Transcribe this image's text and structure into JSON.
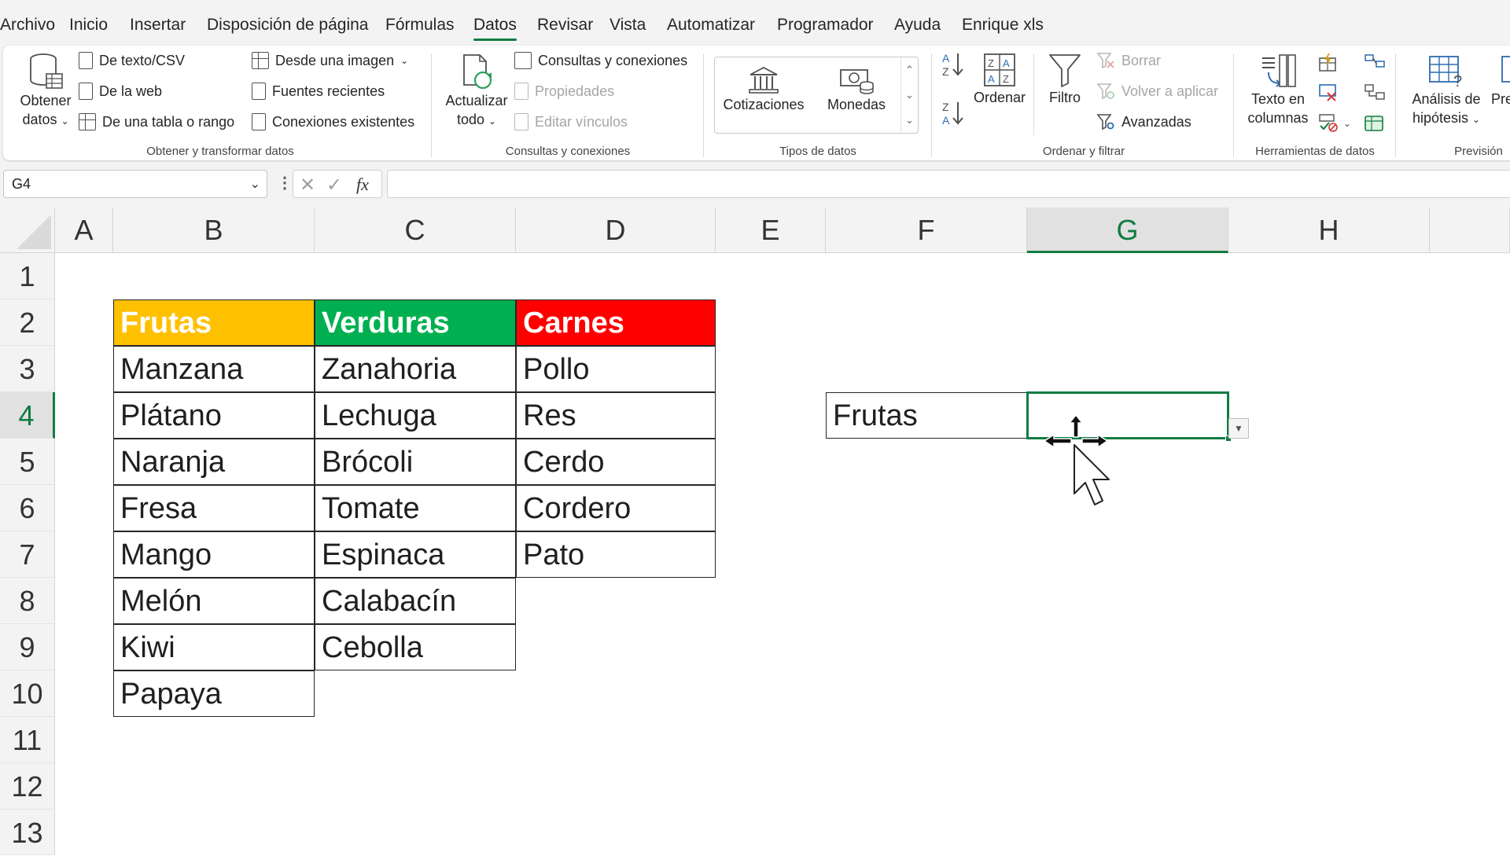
{
  "menu": {
    "tabs": [
      "Archivo",
      "Inicio",
      "Insertar",
      "Disposición de página",
      "Fórmulas",
      "Datos",
      "Revisar",
      "Vista",
      "Automatizar",
      "Programador",
      "Ayuda",
      "Enrique xls"
    ],
    "active": "Datos"
  },
  "ribbon": {
    "obtener_line1": "Obtener",
    "obtener_line2": "datos",
    "de_texto": "De texto/CSV",
    "de_web": "De la web",
    "de_tabla": "De una tabla o rango",
    "desde_imagen": "Desde una imagen",
    "fuentes_recientes": "Fuentes recientes",
    "conexiones_existentes": "Conexiones existentes",
    "group1": "Obtener y transformar datos",
    "actualizar_line1": "Actualizar",
    "actualizar_line2": "todo",
    "consultas_conexiones": "Consultas y conexiones",
    "propiedades": "Propiedades",
    "editar_vinculos": "Editar vínculos",
    "group2": "Consultas y conexiones",
    "cotizaciones": "Cotizaciones",
    "monedas": "Monedas",
    "group3": "Tipos de datos",
    "ordenar": "Ordenar",
    "filtro": "Filtro",
    "borrar": "Borrar",
    "volver_aplicar": "Volver a aplicar",
    "avanzadas": "Avanzadas",
    "group4": "Ordenar y filtrar",
    "texto_line1": "Texto en",
    "texto_line2": "columnas",
    "group5": "Herramientas de datos",
    "analisis_line1": "Análisis de",
    "analisis_line2": "hipótesis",
    "prev_cut": "Prev",
    "group6": "Previsión"
  },
  "formula_bar": {
    "name_box": "G4",
    "fx": "fx",
    "value": ""
  },
  "sheet": {
    "columns": [
      "A",
      "B",
      "C",
      "D",
      "E",
      "F",
      "G",
      "H"
    ],
    "rows": [
      "1",
      "2",
      "3",
      "4",
      "5",
      "6",
      "7",
      "8",
      "9",
      "10",
      "11",
      "12",
      "13"
    ],
    "selected_cell": "G4",
    "headers": {
      "frutas": "Frutas",
      "verduras": "Verduras",
      "carnes": "Carnes"
    },
    "header_colors": {
      "frutas": "#ffc000",
      "verduras": "#00b050",
      "carnes": "#ff0000"
    },
    "frutas": [
      "Manzana",
      "Plátano",
      "Naranja",
      "Fresa",
      "Mango",
      "Melón",
      "Kiwi",
      "Papaya"
    ],
    "verduras": [
      "Zanahoria",
      "Lechuga",
      "Brócoli",
      "Tomate",
      "Espinaca",
      "Calabacín",
      "Cebolla"
    ],
    "carnes": [
      "Pollo",
      "Res",
      "Cerdo",
      "Cordero",
      "Pato"
    ],
    "f4": "Frutas",
    "g4": ""
  }
}
